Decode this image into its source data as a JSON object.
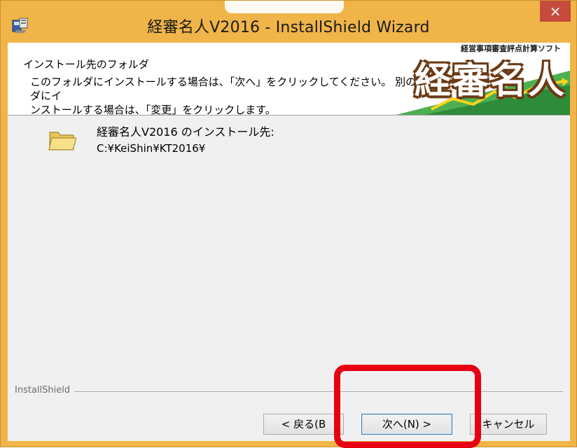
{
  "window": {
    "title": "経審名人V2016 - InstallShield Wizard",
    "close_glyph": "×"
  },
  "header": {
    "title": "インストール先のフォルダ",
    "description_line1": "このフォルダにインストールする場合は、「次へ」をクリックしてください。 別のフォルダにイ",
    "description_line2": "ンストールする場合は、「変更」をクリックします。",
    "banner_sub": "経営事項審査評点計算ソフト",
    "banner_main": "経審名人"
  },
  "destination": {
    "label": "経審名人V2016 のインストール先:",
    "path": "C:¥KeiShin¥KT2016¥"
  },
  "footer": {
    "brand": "InstallShield"
  },
  "buttons": {
    "back": "< 戻る(B",
    "next": "次へ(N) >",
    "cancel": "キャンセル"
  },
  "colors": {
    "title_bar": "#f0b449",
    "close_button": "#c74b3c",
    "highlight": "#e60012"
  }
}
